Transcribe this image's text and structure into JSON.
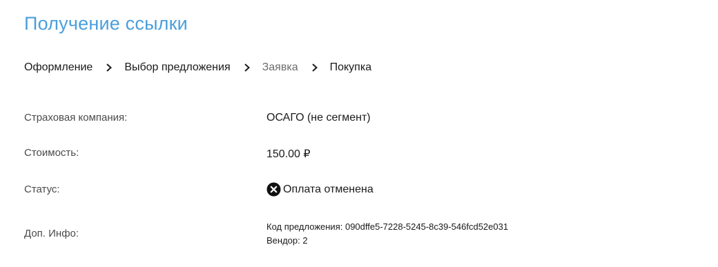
{
  "page": {
    "title": "Получение ссылки"
  },
  "breadcrumb": {
    "items": [
      {
        "label": "Оформление",
        "state": "done"
      },
      {
        "label": "Выбор предложения",
        "state": "done"
      },
      {
        "label": "Заявка",
        "state": "inactive"
      },
      {
        "label": "Покупка",
        "state": "done"
      }
    ],
    "separator_icon": "chevron-right-icon"
  },
  "details": {
    "company": {
      "label": "Страховая компания:",
      "value": "ОСАГО (не сегмент)"
    },
    "cost": {
      "label": "Стоимость:",
      "value": "150.00 ₽"
    },
    "status": {
      "label": "Статус:",
      "value": "Оплата отменена",
      "icon": "cancel-circle-icon"
    },
    "info": {
      "label": "Доп. Инфо:",
      "lines": [
        "Код предложения: 090dffe5-7228-5245-8c39-546fcd52e031",
        "Вендор: 2"
      ]
    }
  },
  "colors": {
    "title": "#4a9fdc",
    "text": "#1a1a1a",
    "muted": "#6b6b6b",
    "status_icon": "#111111"
  }
}
